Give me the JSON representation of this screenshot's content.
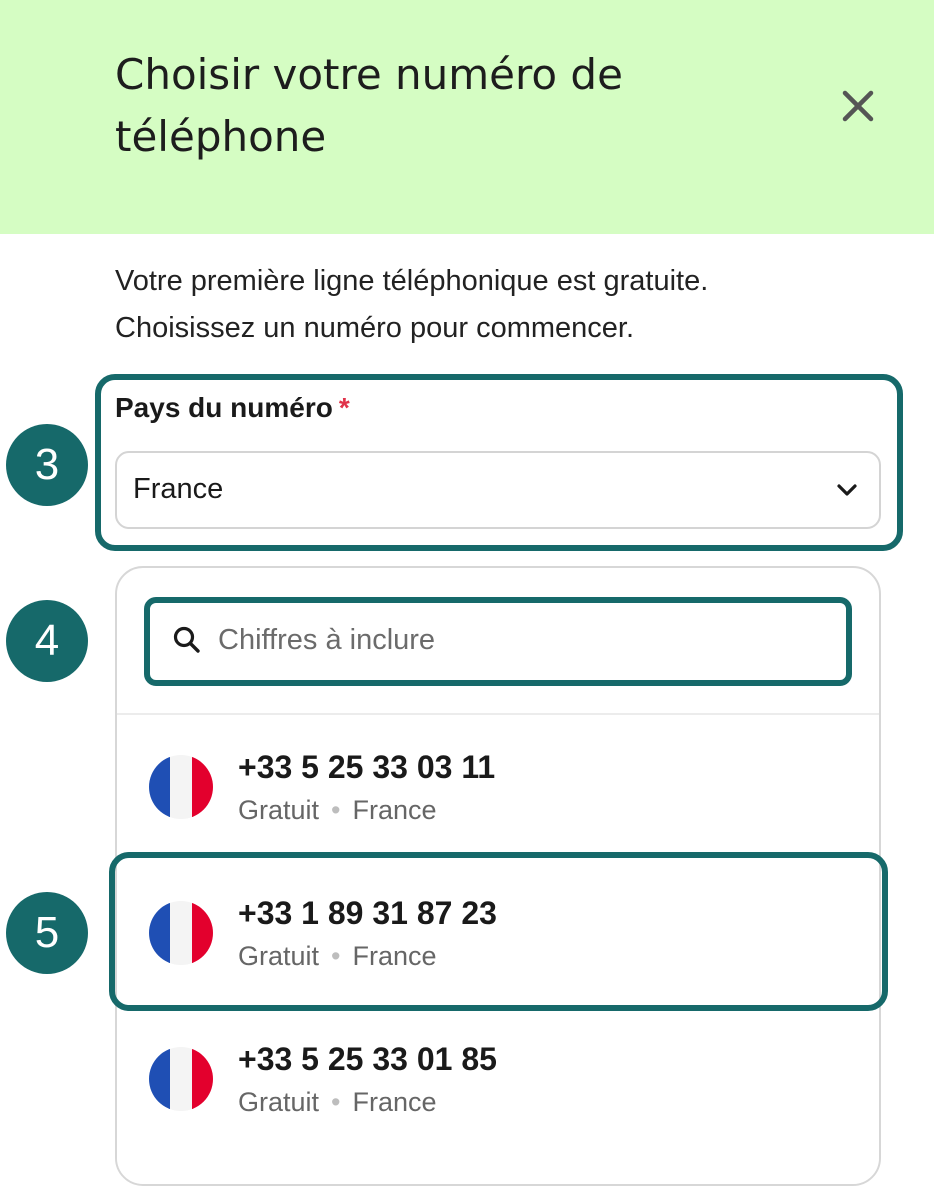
{
  "dialog": {
    "title": "Choisir votre numéro de téléphone",
    "intro": "Votre première ligne téléphonique est gratuite. Choisissez un numéro pour commencer."
  },
  "country_field": {
    "label": "Pays du numéro",
    "required_mark": "*",
    "selected": "France"
  },
  "search": {
    "placeholder": "Chiffres à inclure",
    "value": ""
  },
  "numbers": [
    {
      "number": "+33 5 25 33 03 11",
      "price": "Gratuit",
      "separator": "•",
      "country": "France"
    },
    {
      "number": "+33 1 89 31 87 23",
      "price": "Gratuit",
      "separator": "•",
      "country": "France"
    },
    {
      "number": "+33 5 25 33 01 85",
      "price": "Gratuit",
      "separator": "•",
      "country": "France"
    }
  ],
  "steps": [
    "3",
    "4",
    "5"
  ],
  "colors": {
    "header_bg": "#d5fdc3",
    "accent": "#16696a",
    "required": "#e0334a",
    "flag_blue": "#1f4fb4",
    "flag_white": "#f4f4f4",
    "flag_red": "#e3002d"
  },
  "icons": [
    "close-icon",
    "chevron-down-icon",
    "search-icon",
    "france-flag-icon"
  ]
}
